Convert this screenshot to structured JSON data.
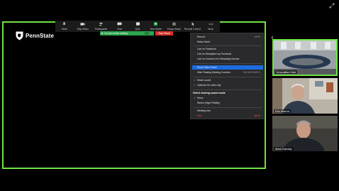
{
  "brand": {
    "logo_text": "PennState"
  },
  "toolbar": {
    "buttons": [
      {
        "label": "Mute",
        "icon": "microphone-icon"
      },
      {
        "label": "Stop Video",
        "icon": "video-camera-icon"
      },
      {
        "label": "Participants",
        "icon": "participants-icon"
      },
      {
        "label": "Chat",
        "icon": "chat-icon"
      },
      {
        "label": "Q&A",
        "icon": "qa-icon"
      },
      {
        "label": "New Share",
        "icon": "share-arrow-icon"
      },
      {
        "label": "Pause Share",
        "icon": "pause-icon"
      },
      {
        "label": "Remote Control",
        "icon": "remote-control-icon"
      },
      {
        "label": "More",
        "icon": "more-dots-icon"
      }
    ],
    "sharing_banner": "You are screen sharing",
    "stop_share": "Stop Share",
    "colors": {
      "banner": "#2da44e",
      "stop": "#d9302c",
      "active_border": "#6fe342",
      "highlight": "#1d6ce0"
    }
  },
  "more_menu": {
    "items": [
      {
        "label": "Record",
        "shortcut": "Alt+R"
      },
      {
        "label": "Raise Hand",
        "shortcut": ""
      },
      {
        "label": "Live on Facebook",
        "shortcut": ""
      },
      {
        "label": "Live on Workplace by Facebook",
        "shortcut": ""
      },
      {
        "label": "Live on Custom Live Streaming Service",
        "shortcut": ""
      },
      {
        "label": "Show Video Panel",
        "shortcut": ""
      },
      {
        "label": "Hide Floating Meeting Controls",
        "shortcut": "Ctrl+Alt+Shift+H"
      },
      {
        "label": "Share sound",
        "shortcut": ""
      },
      {
        "label": "Optimize for video clip",
        "shortcut": ""
      }
    ],
    "sound_header": "Select sharing sound mode",
    "sound_modes": [
      {
        "label": "Mono",
        "checked": true
      },
      {
        "label": "Stereo (High Fidelity)",
        "checked": false
      }
    ],
    "meeting_info": "Meeting Info",
    "end": "End",
    "end_shortcut": "Alt+Q"
  },
  "participants": [
    {
      "name": "Innovation Hub"
    },
    {
      "name": "Eric Barron"
    },
    {
      "name": "Mark Dambly"
    }
  ]
}
